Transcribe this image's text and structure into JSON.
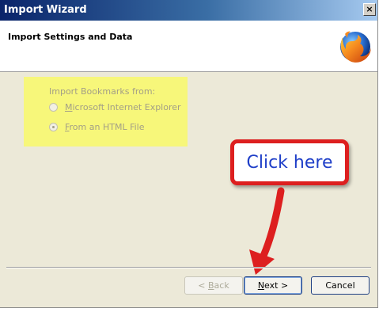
{
  "window": {
    "title": "Import Wizard",
    "close_glyph": "×"
  },
  "header": {
    "title": "Import Settings and Data",
    "logo_icon": "firefox-logo-icon"
  },
  "import_group": {
    "label": "Import Bookmarks from:",
    "options": [
      {
        "accel": "M",
        "rest": "icrosoft Internet Explorer",
        "selected": false
      },
      {
        "accel": "F",
        "rest": "rom an HTML File",
        "selected": true
      }
    ],
    "highlight_color": "#f7f77a"
  },
  "annotation": {
    "callout_text": "Click here",
    "callout_border_color": "#dd1f1f",
    "callout_text_color": "#1f3fc8",
    "arrow_color": "#dd1f1f"
  },
  "buttons": {
    "back": {
      "prefix": "< ",
      "accel": "B",
      "rest": "ack",
      "enabled": false
    },
    "next": {
      "accel": "N",
      "rest": "ext >",
      "enabled": true
    },
    "cancel": {
      "label": "Cancel",
      "enabled": true
    }
  }
}
